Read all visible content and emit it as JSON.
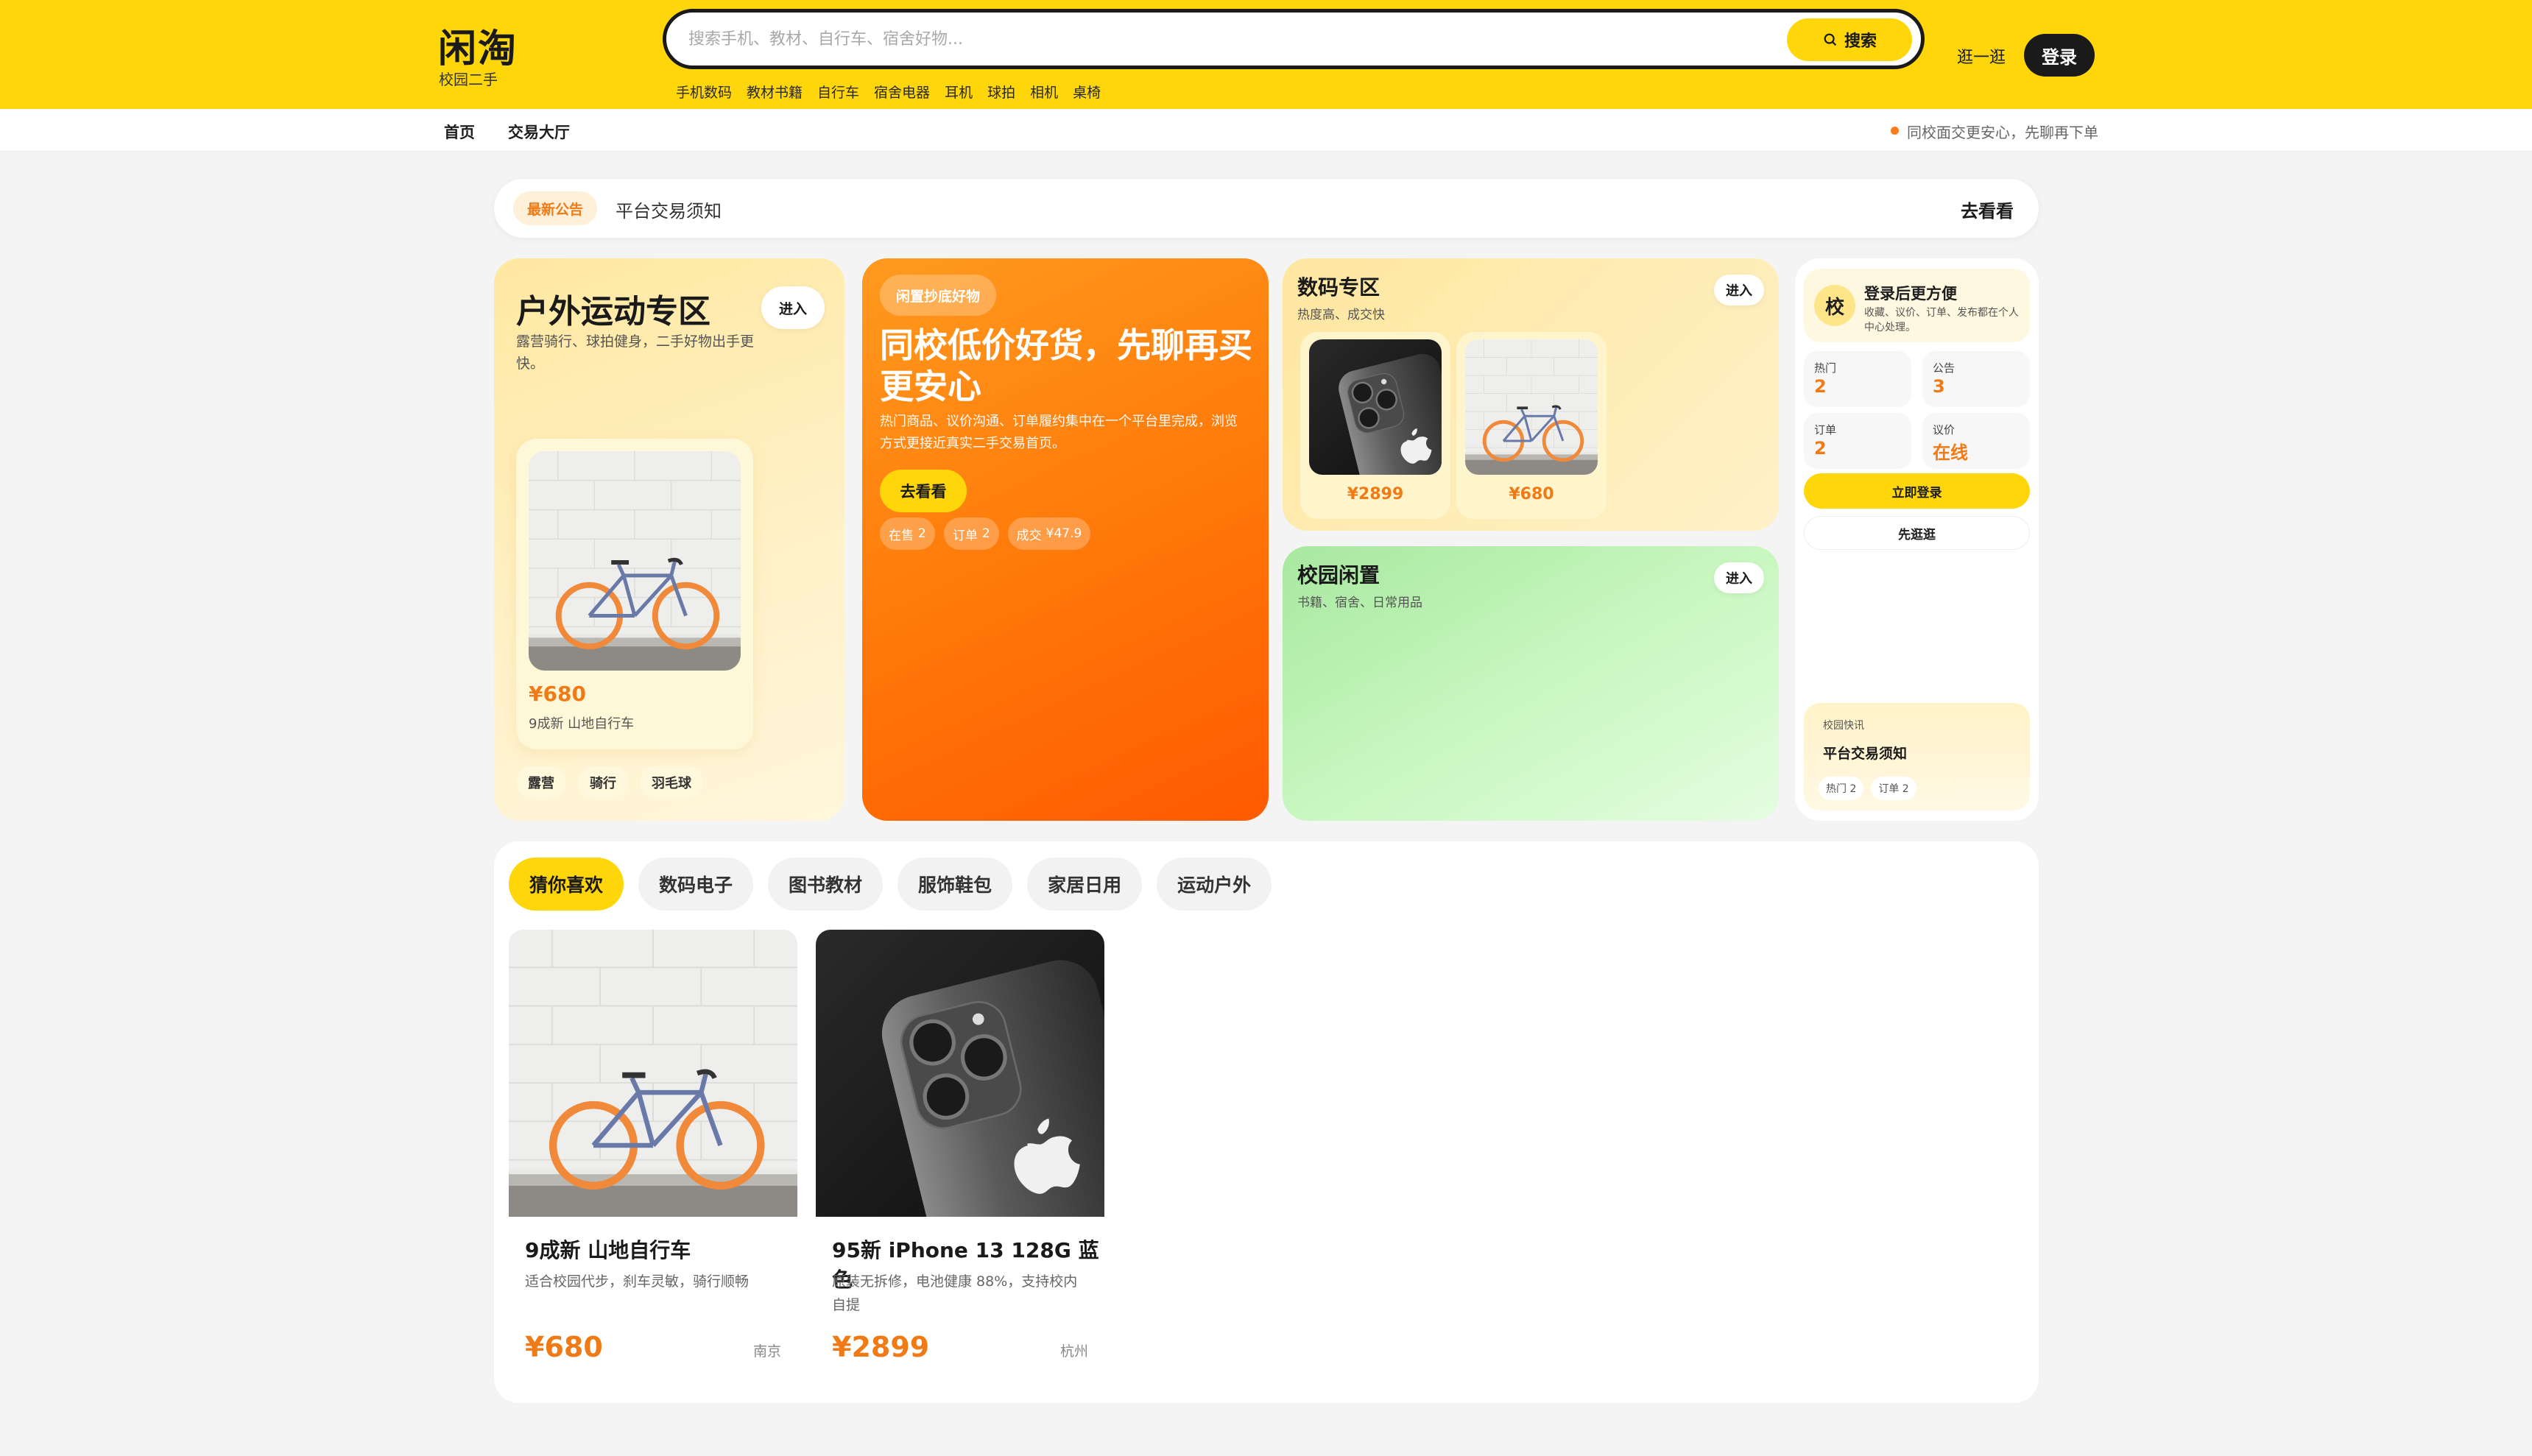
{
  "header": {
    "logo_title": "闲淘",
    "logo_sub": "校园二手",
    "search_placeholder": "搜索手机、教材、自行车、宿舍好物...",
    "search_button": "搜索",
    "hot_tags": [
      "手机数码",
      "教材书籍",
      "自行车",
      "宿舍电器",
      "耳机",
      "球拍",
      "相机",
      "桌椅"
    ],
    "stroll": "逛一逛",
    "login": "登录",
    "brand_color": "#ffd60a"
  },
  "subnav": {
    "home": "首页",
    "hall": "交易大厅",
    "tip": "同校面交更安心，先聊再下单"
  },
  "announcement": {
    "tag": "最新公告",
    "text": "平台交易须知",
    "action": "去看看"
  },
  "outdoor": {
    "title": "户外运动专区",
    "enter": "进入",
    "desc": "露营骑行、球拍健身，二手好物出手更快。",
    "product_price": "¥680",
    "product_name": "9成新 山地自行车",
    "tags": [
      "露营",
      "骑行",
      "羽毛球"
    ]
  },
  "promo": {
    "badge": "闲置抄底好物",
    "title": "同校低价好货，先聊再买更安心",
    "desc": "热门商品、议价沟通、订单履约集中在一个平台里完成，浏览方式更接近真实二手交易首页。",
    "button": "去看看",
    "stats": [
      {
        "label": "在售",
        "value": "2"
      },
      {
        "label": "订单",
        "value": "2"
      },
      {
        "label": "成交",
        "value": "¥47.9"
      }
    ]
  },
  "digital": {
    "title": "数码专区",
    "desc": "热度高、成交快",
    "enter": "进入",
    "products": [
      {
        "price": "¥2899",
        "image": "iphone"
      },
      {
        "price": "¥680",
        "image": "bicycle"
      }
    ]
  },
  "campus": {
    "title": "校园闲置",
    "desc": "书籍、宿舍、日常用品",
    "enter": "进入"
  },
  "login_panel": {
    "avatar": "校",
    "title": "登录后更方便",
    "sub": "收藏、议价、订单、发布都在个人中心处理。",
    "stats": [
      {
        "label": "热门",
        "value": "2"
      },
      {
        "label": "公告",
        "value": "3"
      },
      {
        "label": "订单",
        "value": "2"
      },
      {
        "label": "议价",
        "value": "在线"
      }
    ],
    "login_button": "立即登录",
    "stroll_button": "先逛逛",
    "news_kicker": "校园快讯",
    "news_title": "平台交易须知",
    "news_tags": [
      "热门 2",
      "订单 2"
    ]
  },
  "feed": {
    "tabs": [
      "猜你喜欢",
      "数码电子",
      "图书教材",
      "服饰鞋包",
      "家居日用",
      "运动户外"
    ],
    "active_tab": 0,
    "products": [
      {
        "name": "9成新 山地自行车",
        "desc": "适合校园代步，刹车灵敏，骑行顺畅",
        "price": "¥680",
        "city": "南京",
        "image": "bicycle"
      },
      {
        "name": "95新 iPhone 13 128G 蓝色",
        "desc": "原装无拆修，电池健康 88%，支持校内自提",
        "price": "¥2899",
        "city": "杭州",
        "image": "iphone"
      }
    ]
  }
}
